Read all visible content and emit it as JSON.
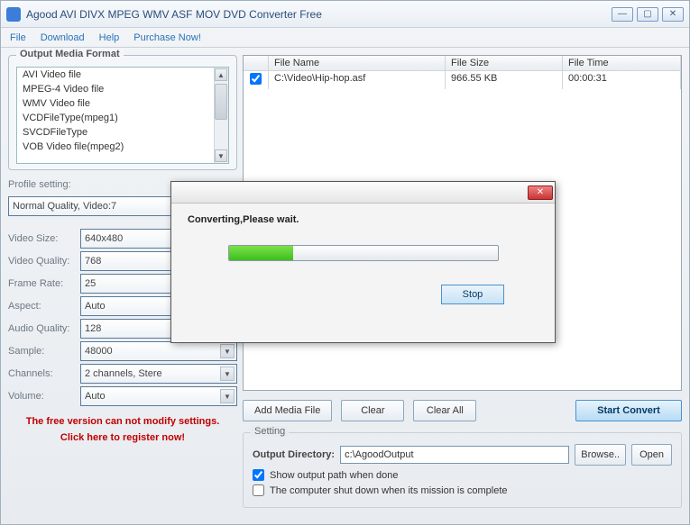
{
  "titlebar": {
    "title": "Agood AVI DIVX MPEG WMV ASF MOV DVD Converter Free"
  },
  "menu": {
    "file": "File",
    "download": "Download",
    "help": "Help",
    "purchase": "Purchase Now!"
  },
  "output_format": {
    "title": "Output Media Format",
    "items": [
      "AVI Video file",
      "MPEG-4 Video file",
      "WMV Video file",
      "VCDFileType(mpeg1)",
      "SVCDFileType",
      "VOB Video file(mpeg2)"
    ]
  },
  "profile": {
    "label": "Profile setting:",
    "value": "Normal Quality, Video:7"
  },
  "settings": {
    "video_size": {
      "label": "Video Size:",
      "value": "640x480"
    },
    "video_quality": {
      "label": "Video Quality:",
      "value": "768"
    },
    "frame_rate": {
      "label": "Frame Rate:",
      "value": "25"
    },
    "aspect": {
      "label": "Aspect:",
      "value": "Auto"
    },
    "audio_quality": {
      "label": "Audio Quality:",
      "value": "128"
    },
    "sample": {
      "label": "Sample:",
      "value": "48000"
    },
    "channels": {
      "label": "Channels:",
      "value": "2 channels, Stere"
    },
    "volume": {
      "label": "Volume:",
      "value": "Auto"
    }
  },
  "free_msg": {
    "line1": "The free version can not modify settings.",
    "line2": "Click here to register now!"
  },
  "table": {
    "headers": {
      "name": "File Name",
      "size": "File Size",
      "time": "File Time"
    },
    "rows": [
      {
        "checked": true,
        "name": "C:\\Video\\Hip-hop.asf",
        "size": "966.55 KB",
        "time": "00:00:31"
      }
    ]
  },
  "buttons": {
    "add": "Add Media File",
    "clear": "Clear",
    "clear_all": "Clear All",
    "start": "Start Convert",
    "browse": "Browse..",
    "open": "Open"
  },
  "output": {
    "group": "Setting",
    "label": "Output Directory:",
    "path": "c:\\AgoodOutput",
    "show_path": "Show output path when done",
    "shutdown": "The computer shut down when its mission is complete"
  },
  "dialog": {
    "message": "Converting,Please wait.",
    "stop": "Stop",
    "progress_percent": 24
  }
}
